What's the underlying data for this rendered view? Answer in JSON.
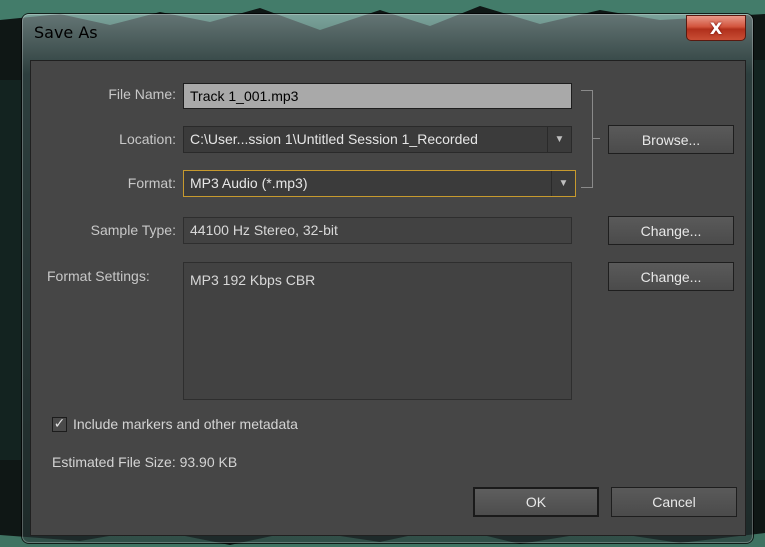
{
  "dialog": {
    "title": "Save As",
    "close_label": "X"
  },
  "form": {
    "file_name": {
      "label": "File Name:",
      "value": "Track 1_001.mp3"
    },
    "location": {
      "label": "Location:",
      "value": "C:\\User...ssion 1\\Untitled Session 1_Recorded"
    },
    "format": {
      "label": "Format:",
      "value": "MP3 Audio (*.mp3)"
    },
    "sample_type": {
      "label": "Sample Type:",
      "value": "44100 Hz Stereo, 32-bit"
    },
    "format_settings": {
      "label": "Format Settings:",
      "value": "MP3 192 Kbps CBR"
    }
  },
  "buttons": {
    "browse": "Browse...",
    "change_sample": "Change...",
    "change_format": "Change...",
    "ok": "OK",
    "cancel": "Cancel"
  },
  "options": {
    "include_markers": {
      "label": "Include markers and other metadata",
      "checked": true
    }
  },
  "status": {
    "estimated_size": "Estimated File Size: 93.90 KB"
  },
  "colors": {
    "client_bg": "#464646",
    "field_highlight": "#a9a9a9",
    "focus_border": "#c79a2e",
    "close_red": "#c94e35"
  }
}
